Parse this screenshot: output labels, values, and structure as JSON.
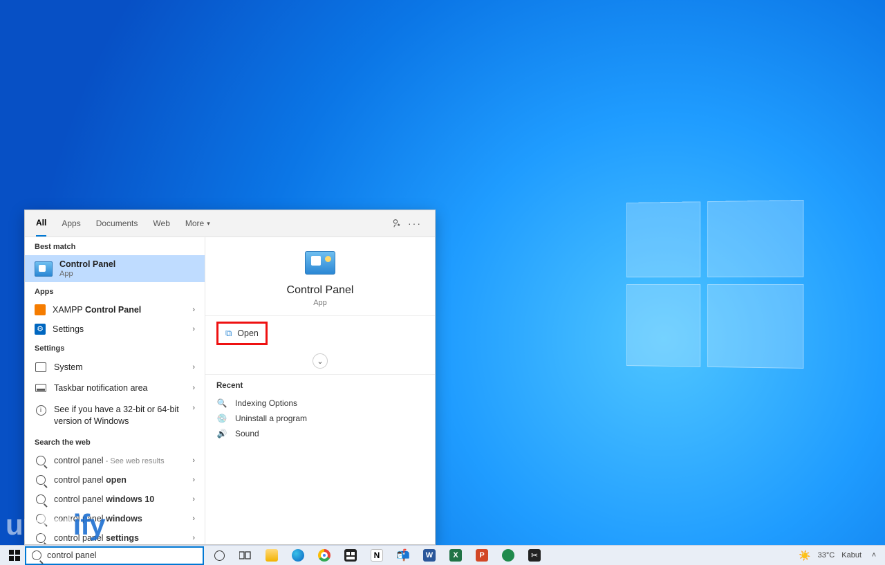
{
  "watermark": {
    "part1": "uplot",
    "part2": "ify"
  },
  "start": {
    "tabs": [
      "All",
      "Apps",
      "Documents",
      "Web",
      "More"
    ],
    "sections": {
      "best_match": "Best match",
      "apps": "Apps",
      "settings": "Settings",
      "search_web": "Search the web"
    },
    "best_match_item": {
      "title": "Control Panel",
      "sub": "App"
    },
    "apps_items": [
      {
        "prefix": "XAMPP ",
        "bold": "Control Panel",
        "icon": "xampp"
      },
      {
        "prefix": "",
        "bold": "Settings",
        "icon": "settings"
      }
    ],
    "settings_items": [
      {
        "label": "System",
        "icon": "system"
      },
      {
        "label": "Taskbar notification area",
        "icon": "taskbar"
      },
      {
        "label": "See if you have a 32-bit or 64-bit version of Windows",
        "icon": "info"
      }
    ],
    "web_items": [
      {
        "prefix": "control panel",
        "bold": "",
        "suffix_hint": " - See web results"
      },
      {
        "prefix": "control panel ",
        "bold": "open",
        "suffix_hint": ""
      },
      {
        "prefix": "control panel ",
        "bold": "windows 10",
        "suffix_hint": ""
      },
      {
        "prefix": "control panel ",
        "bold": "windows",
        "suffix_hint": ""
      },
      {
        "prefix": "control panel ",
        "bold": "settings",
        "suffix_hint": ""
      }
    ],
    "detail": {
      "title": "Control Panel",
      "sub": "App",
      "open_label": "Open",
      "recent_label": "Recent",
      "recent": [
        "Indexing Options",
        "Uninstall a program",
        "Sound"
      ]
    }
  },
  "taskbar": {
    "search_value": "control panel",
    "systray": {
      "weather_temp": "33°C",
      "weather_label": "Kabut"
    }
  }
}
